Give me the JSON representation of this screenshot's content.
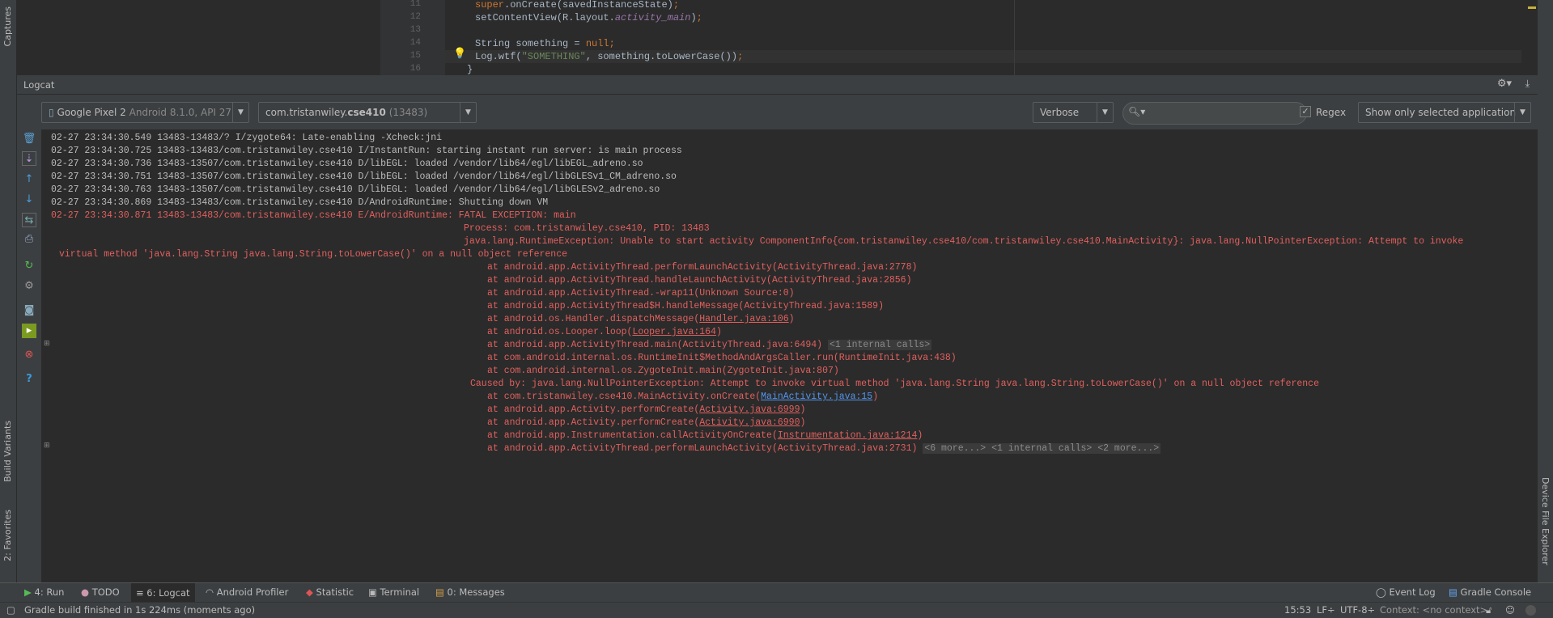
{
  "side_tabs": {
    "captures": "Captures",
    "build_variants": "Build Variants",
    "favorites": "2: Favorites",
    "device_file_explorer": "Device File Explorer"
  },
  "editor": {
    "lines": [
      {
        "num": "11",
        "code": "super.onCreate(savedInstanceState);"
      },
      {
        "num": "12",
        "code": "setContentView(R.layout.activity_main);"
      },
      {
        "num": "13",
        "code": ""
      },
      {
        "num": "14",
        "code": "String something = null;"
      },
      {
        "num": "15",
        "code": "Log.wtf(\"SOMETHING\", something.toLowerCase());"
      },
      {
        "num": "16",
        "code": "}"
      }
    ]
  },
  "logcat": {
    "title": "Logcat",
    "device": {
      "name": "Google Pixel 2",
      "detail": "Android 8.1.0, API 27"
    },
    "process": {
      "prefix": "com.tristanwiley.",
      "bold": "cse410",
      "pid": "(13483)"
    },
    "level": "Verbose",
    "search_value": "",
    "regex_label": "Regex",
    "regex_checked": true,
    "filter": "Show only selected application",
    "lines": [
      {
        "t": "info",
        "ind": "",
        "text": "02-27 23:34:30.549 13483-13483/? I/zygote64: Late-enabling -Xcheck:jni"
      },
      {
        "t": "info",
        "ind": "",
        "text": "02-27 23:34:30.725 13483-13483/com.tristanwiley.cse410 I/InstantRun: starting instant run server: is main process"
      },
      {
        "t": "info",
        "ind": "",
        "text": "02-27 23:34:30.736 13483-13507/com.tristanwiley.cse410 D/libEGL: loaded /vendor/lib64/egl/libEGL_adreno.so"
      },
      {
        "t": "info",
        "ind": "",
        "text": "02-27 23:34:30.751 13483-13507/com.tristanwiley.cse410 D/libEGL: loaded /vendor/lib64/egl/libGLESv1_CM_adreno.so"
      },
      {
        "t": "info",
        "ind": "",
        "text": "02-27 23:34:30.763 13483-13507/com.tristanwiley.cse410 D/libEGL: loaded /vendor/lib64/egl/libGLESv2_adreno.so"
      },
      {
        "t": "info",
        "ind": "",
        "text": "02-27 23:34:30.869 13483-13483/com.tristanwiley.cse410 D/AndroidRuntime: Shutting down VM"
      },
      {
        "t": "err",
        "ind": "",
        "text": "02-27 23:34:30.871 13483-13483/com.tristanwiley.cse410 E/AndroidRuntime: FATAL EXCEPTION: main"
      },
      {
        "t": "err",
        "ind": "ind1",
        "text": "Process: com.tristanwiley.cse410, PID: 13483"
      },
      {
        "t": "err",
        "ind": "ind1",
        "text": "java.lang.RuntimeException: Unable to start activity ComponentInfo{com.tristanwiley.cse410/com.tristanwiley.cse410.MainActivity}: java.lang.NullPointerException: Attempt to invoke"
      },
      {
        "t": "err",
        "ind": "ind0",
        "text": "virtual method 'java.lang.String java.lang.String.toLowerCase()' on a null object reference"
      },
      {
        "t": "err",
        "ind": "ind2",
        "text": "at android.app.ActivityThread.performLaunchActivity(ActivityThread.java:2778)"
      },
      {
        "t": "err",
        "ind": "ind2",
        "text": "at android.app.ActivityThread.handleLaunchActivity(ActivityThread.java:2856)"
      },
      {
        "t": "err",
        "ind": "ind2",
        "text": "at android.app.ActivityThread.-wrap11(Unknown Source:0)"
      },
      {
        "t": "err",
        "ind": "ind2",
        "text": "at android.app.ActivityThread$H.handleMessage(ActivityThread.java:1589)"
      },
      {
        "t": "err",
        "ind": "ind2",
        "text": "at android.os.Handler.dispatchMessage(",
        "link": "Handler.java:106",
        "after": ")"
      },
      {
        "t": "err",
        "ind": "ind2",
        "text": "at android.os.Looper.loop(",
        "link": "Looper.java:164",
        "after": ")"
      },
      {
        "t": "err",
        "ind": "ind2",
        "text": "at android.app.ActivityThread.main(ActivityThread.java:6494)",
        "fold": "<1 internal calls>"
      },
      {
        "t": "err",
        "ind": "ind2",
        "text": "at com.android.internal.os.RuntimeInit$MethodAndArgsCaller.run(RuntimeInit.java:438)"
      },
      {
        "t": "err",
        "ind": "ind2",
        "text": "at com.android.internal.os.ZygoteInit.main(ZygoteInit.java:807)"
      },
      {
        "t": "err",
        "ind": "ind3",
        "text": "Caused by: java.lang.NullPointerException: Attempt to invoke virtual method 'java.lang.String java.lang.String.toLowerCase()' on a null object reference"
      },
      {
        "t": "err",
        "ind": "ind2",
        "text": "at com.tristanwiley.cse410.MainActivity.onCreate(",
        "link": "MainActivity.java:15",
        "after": ")",
        "blue": true
      },
      {
        "t": "err",
        "ind": "ind2",
        "text": "at android.app.Activity.performCreate(",
        "link": "Activity.java:6999",
        "after": ")"
      },
      {
        "t": "err",
        "ind": "ind2",
        "text": "at android.app.Activity.performCreate(",
        "link": "Activity.java:6990",
        "after": ")"
      },
      {
        "t": "err",
        "ind": "ind2",
        "text": "at android.app.Instrumentation.callActivityOnCreate(",
        "link": "Instrumentation.java:1214",
        "after": ")"
      },
      {
        "t": "err",
        "ind": "ind2",
        "text": "at android.app.ActivityThread.performLaunchActivity(ActivityThread.java:2731)",
        "fold": "<6 more...> <1 internal calls> <2 more...>"
      }
    ]
  },
  "tool_windows": {
    "run": "4: Run",
    "todo": "TODO",
    "logcat": "6: Logcat",
    "profiler": "Android Profiler",
    "statistic": "Statistic",
    "terminal": "Terminal",
    "messages": "0: Messages",
    "event_log": "Event Log",
    "gradle_console": "Gradle Console"
  },
  "status": {
    "message": "Gradle build finished in 1s 224ms (moments ago)",
    "position": "15:53",
    "line_sep": "LF÷",
    "encoding": "UTF-8÷",
    "context": "Context: <no context>"
  },
  "colors": {
    "error": "#e0605e",
    "info": "#bbbbbb",
    "background": "#2b2b2b",
    "panel": "#3c3f41"
  }
}
